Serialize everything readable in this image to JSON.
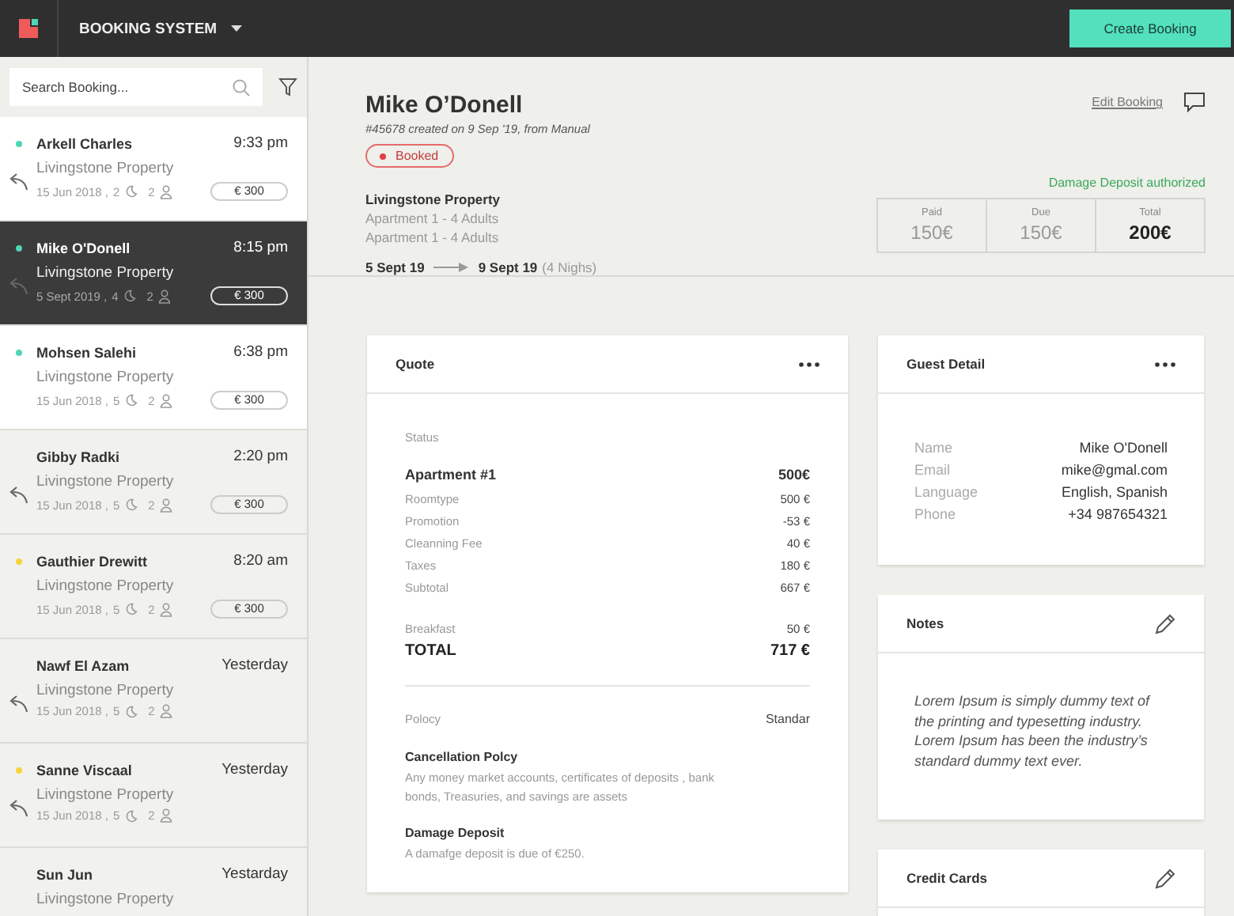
{
  "topbar": {
    "title": "BOOKING SYSTEM",
    "action": "Create Booking"
  },
  "search": {
    "placeholder": "Search Booking..."
  },
  "bookings": [
    {
      "name": "Arkell Charles",
      "time": "9:33 pm",
      "property": "Livingstone Property",
      "date": "15 Jun 2018 ,",
      "nights": "2",
      "guests": "2",
      "price": "€ 300",
      "color": "#4fd6b4",
      "replied": true,
      "unread": true,
      "selected": false
    },
    {
      "name": "Mike O'Donell",
      "time": "8:15 pm",
      "property": "Livingstone Property",
      "date": "5 Sept 2019 ,",
      "nights": "4",
      "guests": "2",
      "price": "€ 300",
      "color": "#4fd6b4",
      "replied": true,
      "unread": true,
      "selected": true
    },
    {
      "name": "Mohsen Salehi",
      "time": "6:38 pm",
      "property": "Livingstone Property",
      "date": "15 Jun 2018 ,",
      "nights": "5",
      "guests": "2",
      "price": "€ 300",
      "color": "#4fd6b4",
      "replied": false,
      "unread": true,
      "selected": false
    },
    {
      "name": "Gibby Radki",
      "time": "2:20 pm",
      "property": "Livingstone Property",
      "date": "15 Jun 2018 ,",
      "nights": "5",
      "guests": "2",
      "price": "€ 300",
      "replied": true,
      "unread": false,
      "selected": false
    },
    {
      "name": "Gauthier Drewitt",
      "time": "8:20 am",
      "property": "Livingstone Property",
      "date": "15 Jun 2018 ,",
      "nights": "5",
      "guests": "2",
      "price": "€ 300",
      "color": "#f5d33f",
      "replied": false,
      "unread": false,
      "selected": false
    },
    {
      "name": "Nawf El Azam",
      "time": "Yesterday",
      "property": "Livingstone Property",
      "date": "15 Jun 2018 ,",
      "nights": "5",
      "guests": "2",
      "replied": true,
      "unread": false,
      "selected": false
    },
    {
      "name": "Sanne Viscaal",
      "time": "Yesterday",
      "property": "Livingstone Property",
      "date": "15 Jun 2018 ,",
      "nights": "5",
      "guests": "2",
      "color": "#f5d33f",
      "replied": true,
      "unread": false,
      "selected": false
    },
    {
      "name": "Sun Jun",
      "time": "Yestarday",
      "property": "Livingstone Property",
      "replied": false,
      "unread": false,
      "selected": false
    }
  ],
  "booking": {
    "guest": "Mike O’Donell",
    "meta": "#45678 created on 9 Sep '19, from Manual",
    "status": "Booked",
    "edit_link": "Edit Booking",
    "property": "Livingstone Property",
    "units": [
      "Apartment 1 - 4 Adults",
      "Apartment 1 - 4 Adults"
    ],
    "check_in": "5 Sept 19",
    "check_out": "9 Sept 19",
    "nights": "(4 Nighs)",
    "deposit_status": "Damage Deposit authorized",
    "payments": [
      {
        "label": "Paid",
        "value": "150€",
        "kind": "amount"
      },
      {
        "label": "Due",
        "value": "150€",
        "kind": "amount"
      },
      {
        "label": "Total",
        "value": "200€",
        "kind": "total"
      }
    ]
  },
  "quote": {
    "title": "Quote",
    "editable": false,
    "rows": [
      {
        "kind": "caption",
        "label": "Status"
      },
      {
        "kind": "item",
        "label": "Apartment #1",
        "value": "500€"
      },
      {
        "kind": "line",
        "label": "Roomtype",
        "value": "500 €"
      },
      {
        "kind": "line",
        "label": "Promotion",
        "value": "-53 €"
      },
      {
        "kind": "line",
        "label": "Cleanning Fee",
        "value": "40 €"
      },
      {
        "kind": "line",
        "label": "Taxes",
        "value": "180 €"
      },
      {
        "kind": "line",
        "label": "Subtotal",
        "value": "667 €"
      },
      {
        "kind": "extra",
        "label": "Breakfast",
        "value": "50 €"
      },
      {
        "kind": "total",
        "label": "TOTAL",
        "value": "717 €"
      },
      {
        "kind": "divider"
      },
      {
        "kind": "policy",
        "label": "Polocy",
        "value": "Standar"
      },
      {
        "kind": "heading",
        "label": "Cancellation Polcy"
      },
      {
        "kind": "text",
        "label": "Any money market accounts, certificates of deposits , bank bonds, Treasuries, and savings are assets"
      },
      {
        "kind": "heading",
        "label": "Damage Deposit"
      },
      {
        "kind": "text",
        "label": "A damafge deposit is due of €250."
      }
    ]
  },
  "guest_detail": {
    "title": "Guest Detail",
    "editable": false,
    "fields": [
      {
        "label": "Name",
        "value": "Mike O'Donell"
      },
      {
        "label": "Email",
        "value": "mike@gmal.com"
      },
      {
        "label": "Language",
        "value": "English, Spanish"
      },
      {
        "label": "Phone",
        "value": "+34 987654321"
      }
    ]
  },
  "notes": {
    "title": "Notes",
    "editable": true,
    "text": "Lorem Ipsum is simply dummy text of the printing and typesetting industry. Lorem Ipsum has been the industry’s standard dummy text ever."
  },
  "credit_cards": {
    "title": "Credit Cards",
    "editable": true
  }
}
